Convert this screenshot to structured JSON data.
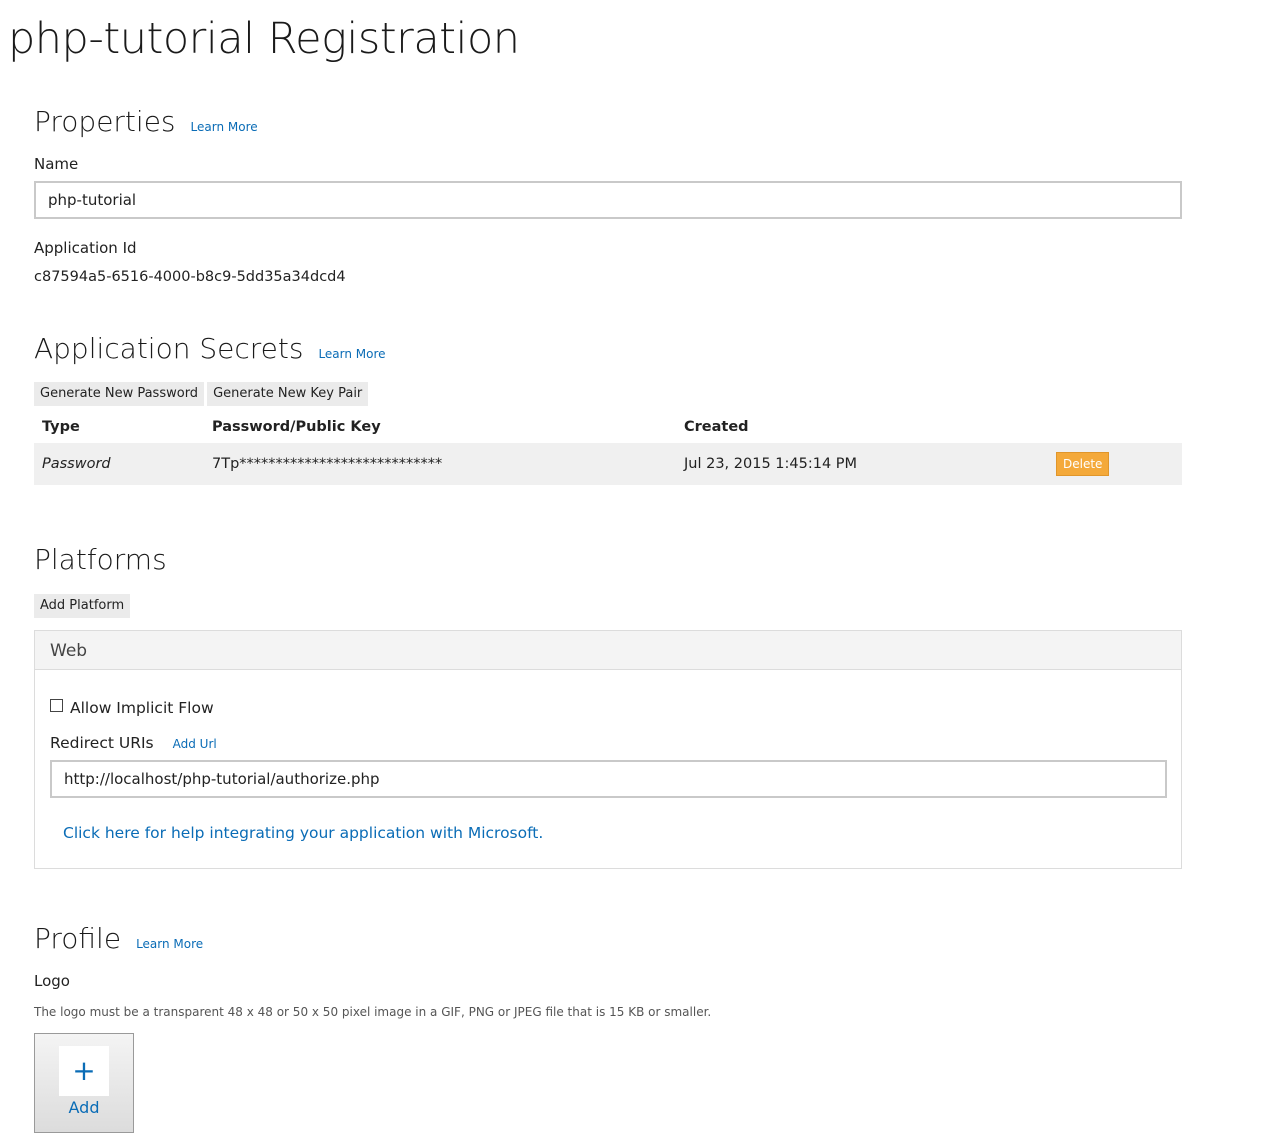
{
  "page": {
    "title": "php-tutorial Registration"
  },
  "properties": {
    "title": "Properties",
    "learn_more": "Learn More",
    "name_label": "Name",
    "name_value": "php-tutorial",
    "app_id_label": "Application Id",
    "app_id_value": "c87594a5-6516-4000-b8c9-5dd35a34dcd4"
  },
  "secrets": {
    "title": "Application Secrets",
    "learn_more": "Learn More",
    "generate_password": "Generate New Password",
    "generate_keypair": "Generate New Key Pair",
    "columns": [
      "Type",
      "Password/Public Key",
      "Created"
    ],
    "rows": [
      {
        "type": "Password",
        "key": "7Tp****************************",
        "created": "Jul 23, 2015 1:45:14 PM",
        "delete_label": "Delete"
      }
    ]
  },
  "platforms": {
    "title": "Platforms",
    "add_platform": "Add Platform",
    "web": {
      "title": "Web",
      "allow_implicit_flow": "Allow Implicit Flow",
      "allow_implicit_checked": false,
      "redirect_label": "Redirect URIs",
      "add_url": "Add Url",
      "redirect_value": "http://localhost/php-tutorial/authorize.php",
      "help_link": "Click here for help integrating your application with Microsoft."
    }
  },
  "profile": {
    "title": "Profile",
    "learn_more": "Learn More",
    "logo_label": "Logo",
    "logo_hint": "The logo must be a transparent 48 x 48 or 50 x 50 pixel image in a GIF, PNG or JPEG file that is 15 KB or smaller.",
    "add_plus": "+",
    "add_label": "Add"
  },
  "colors": {
    "link": "#0a6cb6",
    "delete": "#f4a93a",
    "row_bg": "#f0f0f0"
  }
}
